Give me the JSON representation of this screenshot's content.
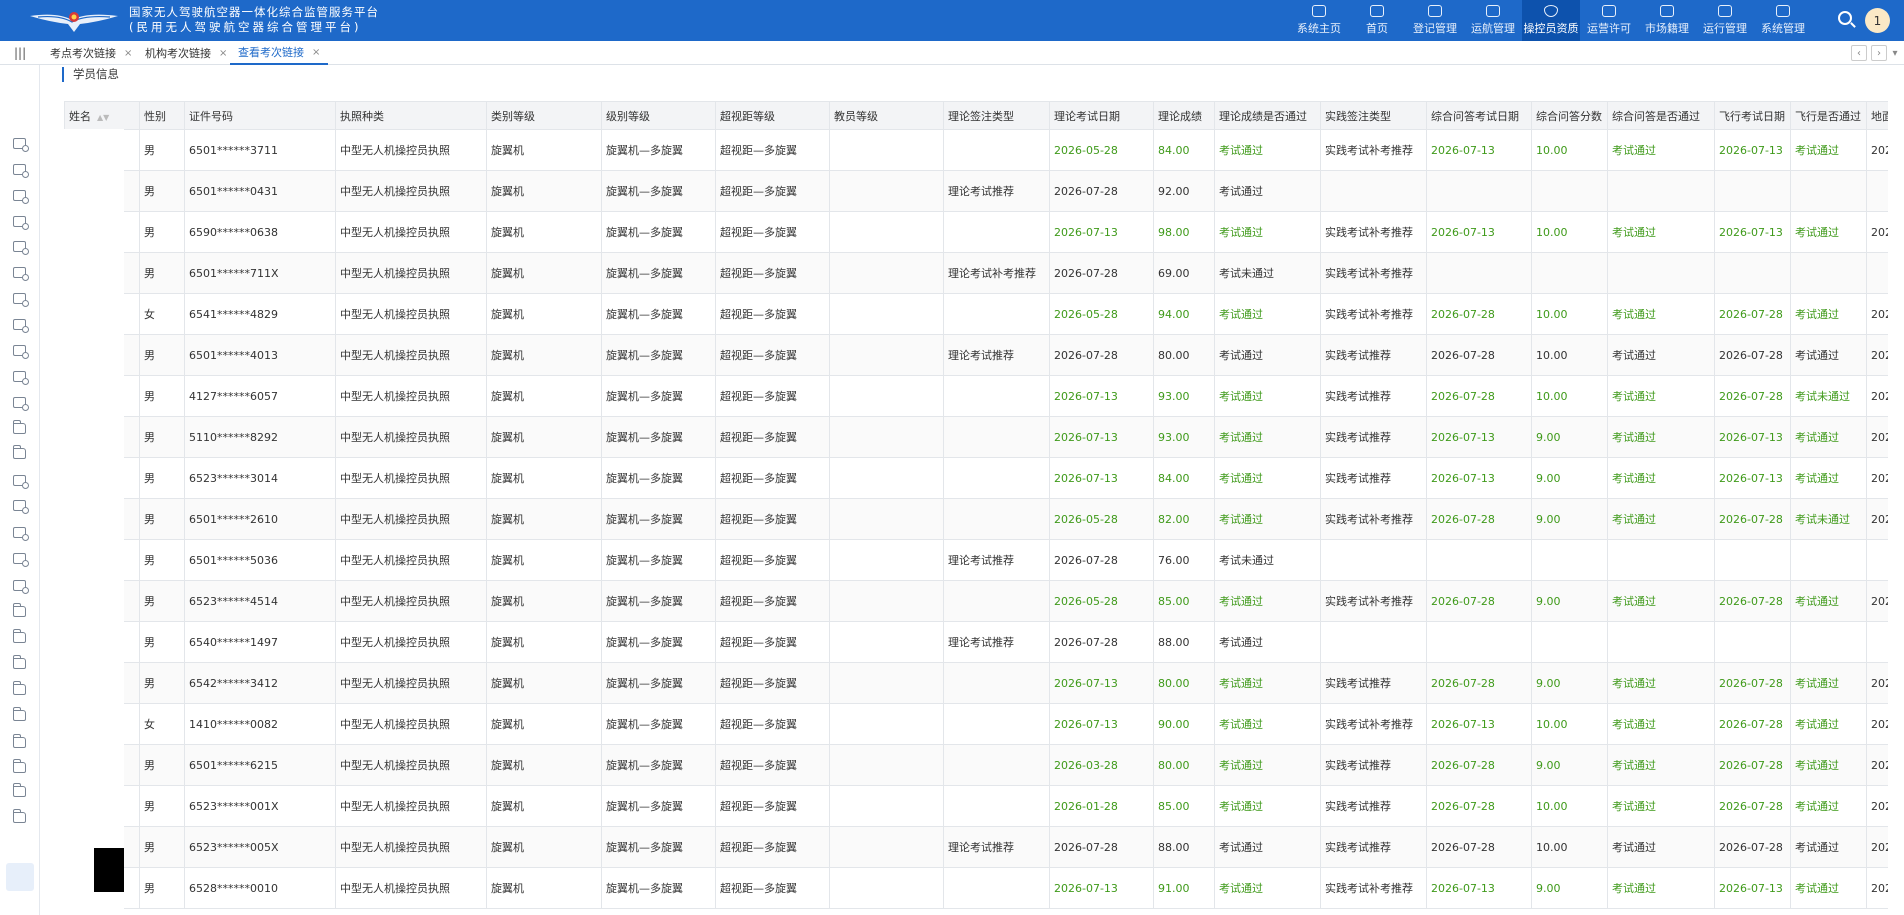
{
  "header": {
    "title_line1": "国家无人驾驶航空器一体化综合监管服务平台",
    "title_line2": "(民用无人驾驶航空器综合管理平台)",
    "logo": "caac-wings-logo",
    "nav": [
      {
        "label": "系统主页",
        "icon": "monitor-icon"
      },
      {
        "label": "首页",
        "icon": "home-icon"
      },
      {
        "label": "登记管理",
        "icon": "register-icon"
      },
      {
        "label": "运航管理",
        "icon": "drone-icon"
      },
      {
        "label": "操控员资质",
        "icon": "shield-icon",
        "active": true
      },
      {
        "label": "运营许可",
        "icon": "permit-icon"
      },
      {
        "label": "市场籍理",
        "icon": "market-icon"
      },
      {
        "label": "运行管理",
        "icon": "refresh-icon"
      },
      {
        "label": "系统管理",
        "icon": "settings-icon"
      }
    ],
    "avatar": "1",
    "accent": "#1e69c9"
  },
  "tabs": [
    {
      "label": "考点考次链接",
      "active": false
    },
    {
      "label": "机构考次链接",
      "active": false
    },
    {
      "label": "查看考次链接",
      "active": true
    }
  ],
  "section": {
    "title": "学员信息"
  },
  "table": {
    "columns": [
      "姓名",
      "性别",
      "证件号码",
      "执照种类",
      "类别等级",
      "级别等级",
      "超视距等级",
      "教员等级",
      "理论签注类型",
      "理论考试日期",
      "理论成绩",
      "理论成绩是否通过",
      "实践签注类型",
      "综合问答考试日期",
      "综合问答分数",
      "综合问答是否通过",
      "飞行考试日期",
      "飞行是否通过",
      "地面"
    ],
    "rows": [
      {
        "gender": "男",
        "id": "6501******3711",
        "license": "中型无人机操控员执照",
        "category": "旋翼机",
        "class": "旋翼机—多旋翼",
        "bvlos": "超视距—多旋翼",
        "theory_type": "",
        "theory_date": "2026-05-28",
        "theory_score": "84.00",
        "theory_pass": "考试通过",
        "practice_type": "实践考试补考推荐",
        "qa_date": "2026-07-13",
        "qa_score": "10.00",
        "qa_pass": "考试通过",
        "flight_date": "2026-07-13",
        "flight_pass": "考试通过",
        "ground": "202"
      },
      {
        "gender": "男",
        "id": "6501******0431",
        "license": "中型无人机操控员执照",
        "category": "旋翼机",
        "class": "旋翼机—多旋翼",
        "bvlos": "超视距—多旋翼",
        "theory_type": "理论考试推荐",
        "theory_date": "2026-07-28",
        "theory_score": "92.00",
        "theory_pass": "考试通过",
        "practice_type": "",
        "qa_date": "",
        "qa_score": "",
        "qa_pass": "",
        "flight_date": "",
        "flight_pass": "",
        "ground": ""
      },
      {
        "gender": "男",
        "id": "6590******0638",
        "license": "中型无人机操控员执照",
        "category": "旋翼机",
        "class": "旋翼机—多旋翼",
        "bvlos": "超视距—多旋翼",
        "theory_type": "",
        "theory_date": "2026-07-13",
        "theory_score": "98.00",
        "theory_pass": "考试通过",
        "practice_type": "实践考试补考推荐",
        "qa_date": "2026-07-13",
        "qa_score": "10.00",
        "qa_pass": "考试通过",
        "flight_date": "2026-07-13",
        "flight_pass": "考试通过",
        "ground": "202"
      },
      {
        "gender": "男",
        "id": "6501******711X",
        "license": "中型无人机操控员执照",
        "category": "旋翼机",
        "class": "旋翼机—多旋翼",
        "bvlos": "超视距—多旋翼",
        "theory_type": "理论考试补考推荐",
        "theory_date": "2026-07-28",
        "theory_score": "69.00",
        "theory_pass": "考试未通过",
        "practice_type": "实践考试补考推荐",
        "qa_date": "",
        "qa_score": "",
        "qa_pass": "",
        "flight_date": "",
        "flight_pass": "",
        "ground": ""
      },
      {
        "gender": "女",
        "id": "6541******4829",
        "license": "中型无人机操控员执照",
        "category": "旋翼机",
        "class": "旋翼机—多旋翼",
        "bvlos": "超视距—多旋翼",
        "theory_type": "",
        "theory_date": "2026-05-28",
        "theory_score": "94.00",
        "theory_pass": "考试通过",
        "practice_type": "实践考试补考推荐",
        "qa_date": "2026-07-28",
        "qa_score": "10.00",
        "qa_pass": "考试通过",
        "flight_date": "2026-07-28",
        "flight_pass": "考试通过",
        "ground": "202"
      },
      {
        "gender": "男",
        "id": "6501******4013",
        "license": "中型无人机操控员执照",
        "category": "旋翼机",
        "class": "旋翼机—多旋翼",
        "bvlos": "超视距—多旋翼",
        "theory_type": "理论考试推荐",
        "theory_date": "2026-07-28",
        "theory_score": "80.00",
        "theory_pass": "考试通过",
        "practice_type": "实践考试推荐",
        "qa_date": "2026-07-28",
        "qa_score": "10.00",
        "qa_pass": "考试通过",
        "flight_date": "2026-07-28",
        "flight_pass": "考试通过",
        "ground": "202"
      },
      {
        "gender": "男",
        "id": "4127******6057",
        "license": "中型无人机操控员执照",
        "category": "旋翼机",
        "class": "旋翼机—多旋翼",
        "bvlos": "超视距—多旋翼",
        "theory_type": "",
        "theory_date": "2026-07-13",
        "theory_score": "93.00",
        "theory_pass": "考试通过",
        "practice_type": "实践考试推荐",
        "qa_date": "2026-07-28",
        "qa_score": "10.00",
        "qa_pass": "考试通过",
        "flight_date": "2026-07-28",
        "flight_pass": "考试未通过",
        "ground": "202"
      },
      {
        "gender": "男",
        "id": "5110******8292",
        "license": "中型无人机操控员执照",
        "category": "旋翼机",
        "class": "旋翼机—多旋翼",
        "bvlos": "超视距—多旋翼",
        "theory_type": "",
        "theory_date": "2026-07-13",
        "theory_score": "93.00",
        "theory_pass": "考试通过",
        "practice_type": "实践考试推荐",
        "qa_date": "2026-07-13",
        "qa_score": "9.00",
        "qa_pass": "考试通过",
        "flight_date": "2026-07-13",
        "flight_pass": "考试通过",
        "ground": "202"
      },
      {
        "gender": "男",
        "id": "6523******3014",
        "license": "中型无人机操控员执照",
        "category": "旋翼机",
        "class": "旋翼机—多旋翼",
        "bvlos": "超视距—多旋翼",
        "theory_type": "",
        "theory_date": "2026-07-13",
        "theory_score": "84.00",
        "theory_pass": "考试通过",
        "practice_type": "实践考试推荐",
        "qa_date": "2026-07-13",
        "qa_score": "9.00",
        "qa_pass": "考试通过",
        "flight_date": "2026-07-13",
        "flight_pass": "考试通过",
        "ground": "202"
      },
      {
        "gender": "男",
        "id": "6501******2610",
        "license": "中型无人机操控员执照",
        "category": "旋翼机",
        "class": "旋翼机—多旋翼",
        "bvlos": "超视距—多旋翼",
        "theory_type": "",
        "theory_date": "2026-05-28",
        "theory_score": "82.00",
        "theory_pass": "考试通过",
        "practice_type": "实践考试补考推荐",
        "qa_date": "2026-07-28",
        "qa_score": "9.00",
        "qa_pass": "考试通过",
        "flight_date": "2026-07-28",
        "flight_pass": "考试未通过",
        "ground": "202"
      },
      {
        "gender": "男",
        "id": "6501******5036",
        "license": "中型无人机操控员执照",
        "category": "旋翼机",
        "class": "旋翼机—多旋翼",
        "bvlos": "超视距—多旋翼",
        "theory_type": "理论考试推荐",
        "theory_date": "2026-07-28",
        "theory_score": "76.00",
        "theory_pass": "考试未通过",
        "practice_type": "",
        "qa_date": "",
        "qa_score": "",
        "qa_pass": "",
        "flight_date": "",
        "flight_pass": "",
        "ground": ""
      },
      {
        "gender": "男",
        "id": "6523******4514",
        "license": "中型无人机操控员执照",
        "category": "旋翼机",
        "class": "旋翼机—多旋翼",
        "bvlos": "超视距—多旋翼",
        "theory_type": "",
        "theory_date": "2026-05-28",
        "theory_score": "85.00",
        "theory_pass": "考试通过",
        "practice_type": "实践考试补考推荐",
        "qa_date": "2026-07-28",
        "qa_score": "9.00",
        "qa_pass": "考试通过",
        "flight_date": "2026-07-28",
        "flight_pass": "考试通过",
        "ground": "202"
      },
      {
        "gender": "男",
        "id": "6540******1497",
        "license": "中型无人机操控员执照",
        "category": "旋翼机",
        "class": "旋翼机—多旋翼",
        "bvlos": "超视距—多旋翼",
        "theory_type": "理论考试推荐",
        "theory_date": "2026-07-28",
        "theory_score": "88.00",
        "theory_pass": "考试通过",
        "practice_type": "",
        "qa_date": "",
        "qa_score": "",
        "qa_pass": "",
        "flight_date": "",
        "flight_pass": "",
        "ground": ""
      },
      {
        "gender": "男",
        "id": "6542******3412",
        "license": "中型无人机操控员执照",
        "category": "旋翼机",
        "class": "旋翼机—多旋翼",
        "bvlos": "超视距—多旋翼",
        "theory_type": "",
        "theory_date": "2026-07-13",
        "theory_score": "80.00",
        "theory_pass": "考试通过",
        "practice_type": "实践考试推荐",
        "qa_date": "2026-07-28",
        "qa_score": "9.00",
        "qa_pass": "考试通过",
        "flight_date": "2026-07-28",
        "flight_pass": "考试通过",
        "ground": "202"
      },
      {
        "gender": "女",
        "id": "1410******0082",
        "license": "中型无人机操控员执照",
        "category": "旋翼机",
        "class": "旋翼机—多旋翼",
        "bvlos": "超视距—多旋翼",
        "theory_type": "",
        "theory_date": "2026-07-13",
        "theory_score": "90.00",
        "theory_pass": "考试通过",
        "practice_type": "实践考试补考推荐",
        "qa_date": "2026-07-13",
        "qa_score": "10.00",
        "qa_pass": "考试通过",
        "flight_date": "2026-07-28",
        "flight_pass": "考试通过",
        "ground": "202"
      },
      {
        "gender": "男",
        "id": "6501******6215",
        "license": "中型无人机操控员执照",
        "category": "旋翼机",
        "class": "旋翼机—多旋翼",
        "bvlos": "超视距—多旋翼",
        "theory_type": "",
        "theory_date": "2026-03-28",
        "theory_score": "80.00",
        "theory_pass": "考试通过",
        "practice_type": "实践考试推荐",
        "qa_date": "2026-07-28",
        "qa_score": "9.00",
        "qa_pass": "考试通过",
        "flight_date": "2026-07-28",
        "flight_pass": "考试通过",
        "ground": "202"
      },
      {
        "gender": "男",
        "id": "6523******001X",
        "license": "中型无人机操控员执照",
        "category": "旋翼机",
        "class": "旋翼机—多旋翼",
        "bvlos": "超视距—多旋翼",
        "theory_type": "",
        "theory_date": "2026-01-28",
        "theory_score": "85.00",
        "theory_pass": "考试通过",
        "practice_type": "实践考试推荐",
        "qa_date": "2026-07-28",
        "qa_score": "10.00",
        "qa_pass": "考试通过",
        "flight_date": "2026-07-28",
        "flight_pass": "考试通过",
        "ground": "202"
      },
      {
        "gender": "男",
        "id": "6523******005X",
        "license": "中型无人机操控员执照",
        "category": "旋翼机",
        "class": "旋翼机—多旋翼",
        "bvlos": "超视距—多旋翼",
        "theory_type": "理论考试推荐",
        "theory_date": "2026-07-28",
        "theory_score": "88.00",
        "theory_pass": "考试通过",
        "practice_type": "实践考试推荐",
        "qa_date": "2026-07-28",
        "qa_score": "10.00",
        "qa_pass": "考试通过",
        "flight_date": "2026-07-28",
        "flight_pass": "考试通过",
        "ground": "202"
      },
      {
        "gender": "男",
        "id": "6528******0010",
        "license": "中型无人机操控员执照",
        "category": "旋翼机",
        "class": "旋翼机—多旋翼",
        "bvlos": "超视距—多旋翼",
        "theory_type": "",
        "theory_date": "2026-07-13",
        "theory_score": "91.00",
        "theory_pass": "考试通过",
        "practice_type": "实践考试补考推荐",
        "qa_date": "2026-07-13",
        "qa_score": "9.00",
        "qa_pass": "考试通过",
        "flight_date": "2026-07-13",
        "flight_pass": "考试通过",
        "ground": "202"
      }
    ]
  }
}
